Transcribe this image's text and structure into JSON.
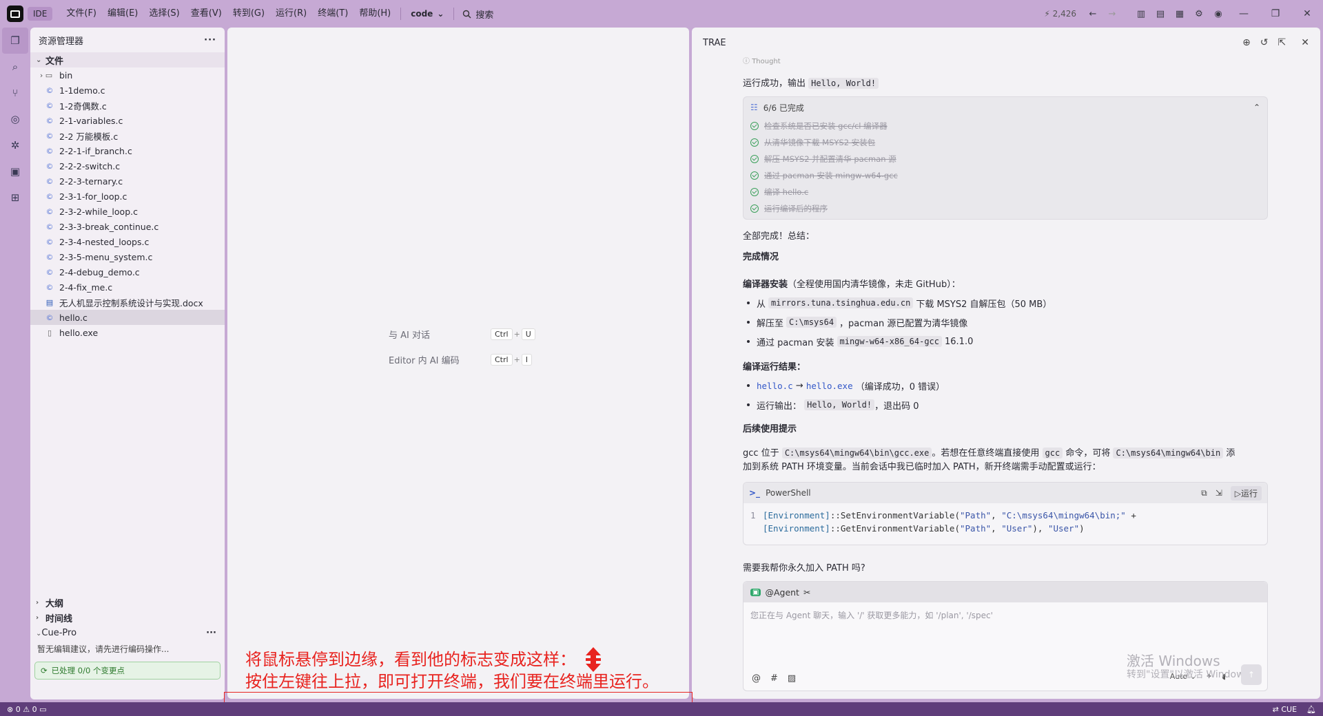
{
  "titlebar": {
    "ide_label": "IDE",
    "menu": [
      "文件(F)",
      "编辑(E)",
      "选择(S)",
      "查看(V)",
      "转到(G)",
      "运行(R)",
      "终端(T)",
      "帮助(H)"
    ],
    "code_label": "code",
    "search_label": "搜索",
    "count": "2,426"
  },
  "explorer": {
    "title": "资源管理器",
    "section": "文件",
    "items": [
      {
        "name": "bin",
        "type": "folder"
      },
      {
        "name": "1-1demo.c",
        "type": "c"
      },
      {
        "name": "1-2奇偶数.c",
        "type": "c"
      },
      {
        "name": "2-1-variables.c",
        "type": "c"
      },
      {
        "name": "2-2 万能模板.c",
        "type": "c"
      },
      {
        "name": "2-2-1-if_branch.c",
        "type": "c"
      },
      {
        "name": "2-2-2-switch.c",
        "type": "c"
      },
      {
        "name": "2-2-3-ternary.c",
        "type": "c"
      },
      {
        "name": "2-3-1-for_loop.c",
        "type": "c"
      },
      {
        "name": "2-3-2-while_loop.c",
        "type": "c"
      },
      {
        "name": "2-3-3-break_continue.c",
        "type": "c"
      },
      {
        "name": "2-3-4-nested_loops.c",
        "type": "c"
      },
      {
        "name": "2-3-5-menu_system.c",
        "type": "c"
      },
      {
        "name": "2-4-debug_demo.c",
        "type": "c"
      },
      {
        "name": "2-4-fix_me.c",
        "type": "c"
      },
      {
        "name": "无人机显示控制系统设计与实现.docx",
        "type": "docx"
      },
      {
        "name": "hello.c",
        "type": "c",
        "selected": true
      },
      {
        "name": "hello.exe",
        "type": "file"
      }
    ],
    "outline": "大纲",
    "timeline": "时间线",
    "cue_title": "Cue-Pro",
    "cue_text": "暂无编辑建议，请先进行编码操作...",
    "cue_status": "已处理 0/0 个变更点"
  },
  "editor": {
    "shortcuts": [
      {
        "label": "与 AI 对话",
        "keys": [
          "Ctrl",
          "U"
        ]
      },
      {
        "label": "Editor 内 AI 编码",
        "keys": [
          "Ctrl",
          "I"
        ]
      }
    ]
  },
  "trae": {
    "title": "TRAE",
    "thought": "Thought",
    "run_success_prefix": "运行成功，输出",
    "run_success_code": "Hello, World!",
    "todo_header": "6/6 已完成",
    "todos": [
      "检查系统是否已安装 gcc/cl 编译器",
      "从清华镜像下载 MSYS2 安装包",
      "解压 MSYS2 并配置清华 pacman 源",
      "通过 pacman 安装 mingw-w64-gcc",
      "编译 hello.c",
      "运行编译后的程序"
    ],
    "all_done": "全部完成！总结：",
    "h_status": "完成情况",
    "compiler_install_bold": "编译器安装",
    "compiler_install_rest": "（全程使用国内清华镜像，未走 GitHub）：",
    "bullets1": [
      {
        "pre": "从",
        "code": "mirrors.tuna.tsinghua.edu.cn",
        "post": "下载 MSYS2 自解压包（50 MB）"
      },
      {
        "pre": "解压至",
        "code": "C:\\msys64",
        "post": "，pacman 源已配置为清华镜像"
      },
      {
        "pre": "通过 pacman 安装",
        "code": "mingw-w64-x86_64-gcc",
        "post": "16.1.0"
      }
    ],
    "compile_result": "编译运行结果：",
    "b2_link1": "hello.c",
    "b2_arrow": "→",
    "b2_link2": "hello.exe",
    "b2_rest": "（编译成功，0 错误）",
    "b3_pre": "运行输出：",
    "b3_code": "Hello, World!",
    "b3_post": "，退出码 0",
    "h_tips": "后续使用提示",
    "tip_p1_pre": "gcc 位于",
    "tip_p1_code1": "C:\\msys64\\mingw64\\bin\\gcc.exe",
    "tip_p1_mid": "。若想在任意终端直接使用",
    "tip_p1_code2": "gcc",
    "tip_p1_mid2": "命令，可将",
    "tip_p1_code3": "C:\\msys64\\mingw64\\bin",
    "tip_p1_post": "添",
    "tip_p2": "加到系统 PATH 环境变量。当前会话中我已临时加入 PATH，新开终端需手动配置或运行：",
    "ps_title": "PowerShell",
    "ps_run": "运行",
    "ps_line_no": "1",
    "ps_line1_kw": "[Environment]",
    "ps_line1_rest": "::SetEnvironmentVariable(",
    "ps_line1_s1": "\"Path\"",
    "ps_line1_s2": "\"C:\\msys64\\mingw64\\bin;\"",
    "ps_line1_end": " +",
    "ps_line2_kw": "[Environment]",
    "ps_line2_rest": "::GetEnvironmentVariable(",
    "ps_line2_s1": "\"Path\"",
    "ps_line2_s2": "\"User\"",
    "ps_line2_s3": "\"User\"",
    "ask_path": "需要我帮你永久加入 PATH 吗?",
    "agent_label": "@Agent",
    "agent_placeholder": "您正在与 Agent 聊天，输入 '/' 获取更多能力，如 '/plan', '/spec'",
    "auto_label": "Auto",
    "watermark1": "激活 Windows",
    "watermark2": "转到\"设置\"以激活 Windows。"
  },
  "annotation": {
    "line1": "将鼠标悬停到边缘，看到他的标志变成这样：",
    "line2": "按住左键往上拉，即可打开终端，我们要在终端里运行。"
  },
  "status": {
    "errors": "0",
    "warnings": "0",
    "cue": "CUE"
  },
  "colors": {
    "accent": "#c6a9d4",
    "status_bar": "#5f3d7a",
    "annotation": "#e8231f",
    "link": "#3257c8",
    "success": "#3aa05a"
  }
}
